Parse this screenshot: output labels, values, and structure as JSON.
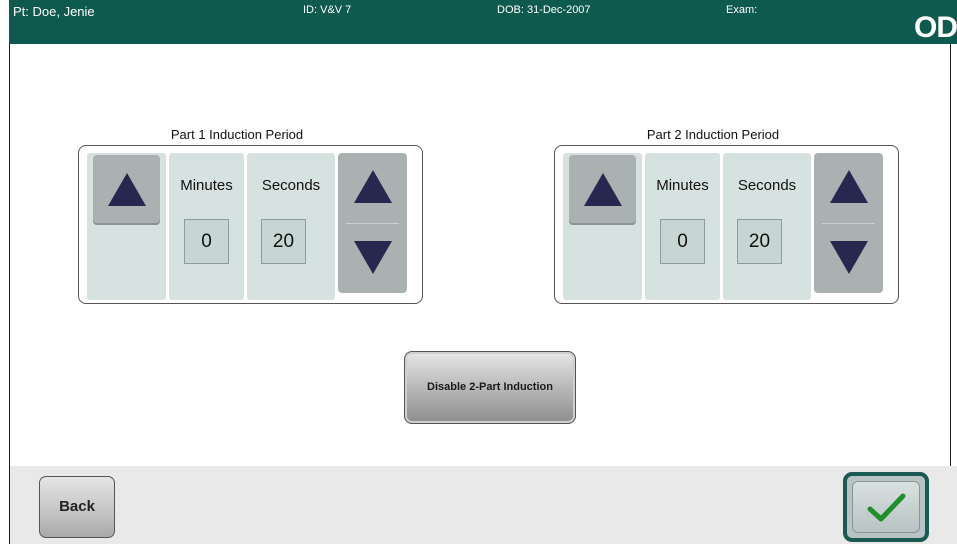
{
  "header": {
    "patient": "Pt: Doe, Jenie",
    "id": "ID: V&V 7",
    "dob": "DOB: 31-Dec-2007",
    "exam": "Exam:",
    "eye": "OD",
    "bg_color": "#0f5a4e"
  },
  "part1": {
    "title": "Part 1 Induction Period",
    "minutes_label": "Minutes",
    "seconds_label": "Seconds",
    "minutes_value": "0",
    "seconds_value": "20"
  },
  "part2": {
    "title": "Part 2 Induction Period",
    "minutes_label": "Minutes",
    "seconds_label": "Seconds",
    "minutes_value": "0",
    "seconds_value": "20"
  },
  "actions": {
    "disable_label": "Disable 2-Part Induction",
    "back_label": "Back",
    "confirm_icon": "checkmark-icon",
    "confirm_color": "#1f8f2a"
  },
  "icons": {
    "up": "up-arrow-icon",
    "down": "down-arrow-icon",
    "arrow_color": "#27284f"
  }
}
